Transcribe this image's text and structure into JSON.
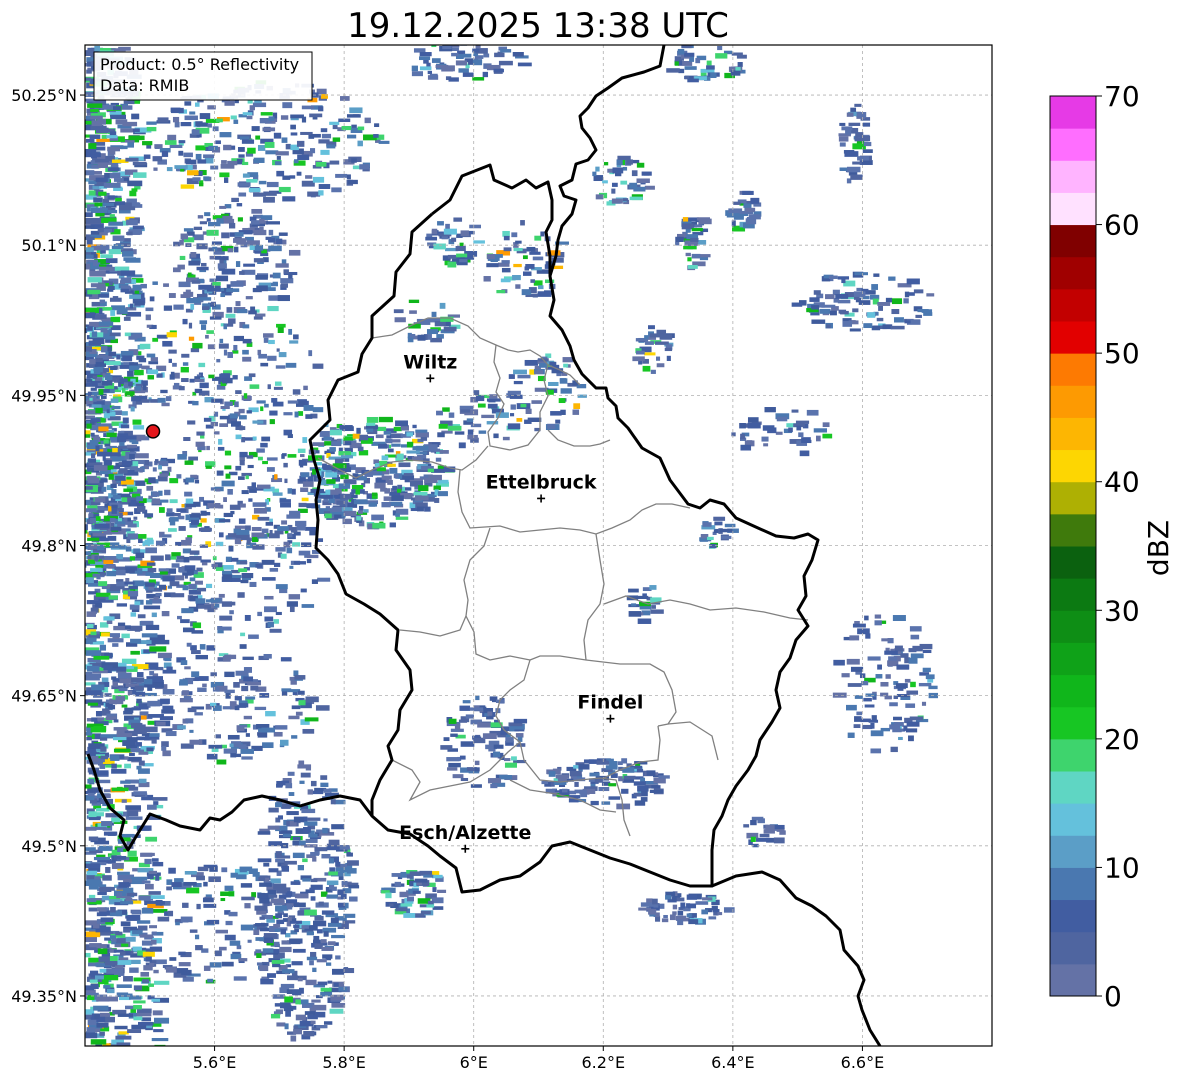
{
  "title": "19.12.2025 13:38 UTC",
  "info_box": {
    "product": "Product: 0.5° Reflectivity",
    "data": "Data: RMIB"
  },
  "map": {
    "lon_range": [
      5.4,
      6.8
    ],
    "lat_range": [
      49.3,
      50.3
    ]
  },
  "x_ticks": [
    {
      "value": 5.6,
      "label": "5.6°E"
    },
    {
      "value": 5.8,
      "label": "5.8°E"
    },
    {
      "value": 6.0,
      "label": "6°E"
    },
    {
      "value": 6.2,
      "label": "6.2°E"
    },
    {
      "value": 6.4,
      "label": "6.4°E"
    },
    {
      "value": 6.6,
      "label": "6.6°E"
    }
  ],
  "y_ticks": [
    {
      "value": 50.25,
      "label": "50.25°N"
    },
    {
      "value": 50.1,
      "label": "50.1°N"
    },
    {
      "value": 49.95,
      "label": "49.95°N"
    },
    {
      "value": 49.8,
      "label": "49.8°N"
    },
    {
      "value": 49.65,
      "label": "49.65°N"
    },
    {
      "value": 49.5,
      "label": "49.5°N"
    },
    {
      "value": 49.35,
      "label": "49.35°N"
    }
  ],
  "cities": [
    {
      "name": "Wiltz",
      "lon": 5.933,
      "lat": 49.967
    },
    {
      "name": "Ettelbruck",
      "lon": 6.104,
      "lat": 49.847
    },
    {
      "name": "Findel",
      "lon": 6.211,
      "lat": 49.627
    },
    {
      "name": "Esch/Alzette",
      "lon": 5.987,
      "lat": 49.497
    }
  ],
  "radar_site": {
    "lon": 5.505,
    "lat": 49.914,
    "color": "#e3161b"
  },
  "colorbar": {
    "label": "dBZ",
    "min": 0,
    "max": 70,
    "ticks": [
      0,
      10,
      20,
      30,
      40,
      50,
      60,
      70
    ],
    "colors": [
      "#6472a6",
      "#4f65a0",
      "#415da1",
      "#4a78b0",
      "#5b9ec7",
      "#64c1dc",
      "#5fd6c3",
      "#3ed46d",
      "#17c623",
      "#10b61b",
      "#0fa218",
      "#0e8e15",
      "#0c7a12",
      "#0b610f",
      "#3f7a0c",
      "#aeb003",
      "#fdd602",
      "#fdb602",
      "#fd9a02",
      "#fd7a02",
      "#e20000",
      "#c20000",
      "#a00000",
      "#800000",
      "#ffe1ff",
      "#ffb4ff",
      "#ff6eff",
      "#e63ae6"
    ]
  },
  "colors": {
    "border_country": "#000000",
    "border_canton": "#808080",
    "grid": "#b0b0b0"
  }
}
